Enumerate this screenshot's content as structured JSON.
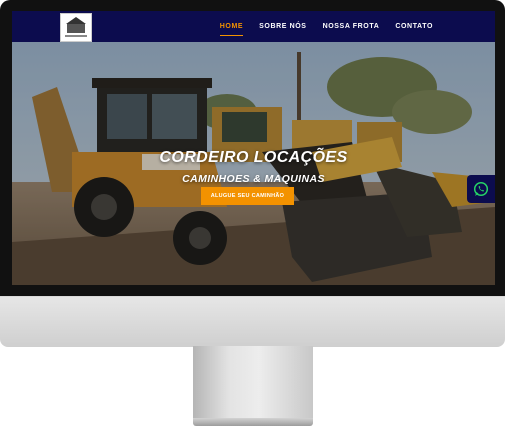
{
  "nav": {
    "items": [
      {
        "label": "HOME",
        "active": true
      },
      {
        "label": "SOBRE NÓS",
        "active": false
      },
      {
        "label": "NOSSA FROTA",
        "active": false
      },
      {
        "label": "CONTATO",
        "active": false
      }
    ]
  },
  "hero": {
    "title": "CORDEIRO LOCAÇÕES",
    "subtitle": "CAMINHOES & MAQUINAS",
    "cta_label": "ALUGUE SEU CAMINHÃO"
  },
  "floating": {
    "icon": "whatsapp-icon"
  },
  "colors": {
    "nav_bg": "#0c0c4e",
    "accent": "#f39200",
    "whatsapp": "#25d366"
  }
}
